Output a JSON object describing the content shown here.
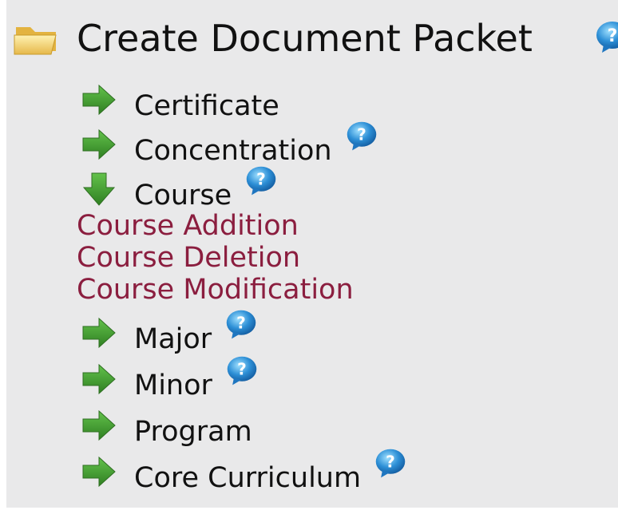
{
  "header": {
    "title": "Create Document Packet",
    "folder_icon": "folder-open-icon",
    "help_icon": "help-bubble-icon"
  },
  "items": [
    {
      "label": "Certificate",
      "state": "collapsed",
      "has_help": false
    },
    {
      "label": "Concentration",
      "state": "collapsed",
      "has_help": true
    },
    {
      "label": "Course",
      "state": "expanded",
      "has_help": true
    },
    {
      "label": "Major",
      "state": "collapsed",
      "has_help": true
    },
    {
      "label": "Minor",
      "state": "collapsed",
      "has_help": true
    },
    {
      "label": "Program",
      "state": "collapsed",
      "has_help": false
    },
    {
      "label": "Core Curriculum",
      "state": "collapsed",
      "has_help": true
    }
  ],
  "course_links": [
    "Course Addition",
    "Course Deletion",
    "Course Modification"
  ],
  "colors": {
    "panel_bg": "#e9e9ea",
    "link": "#8b1e3f",
    "arrow": "#3f9a2e",
    "help": "#2d8fd6"
  }
}
